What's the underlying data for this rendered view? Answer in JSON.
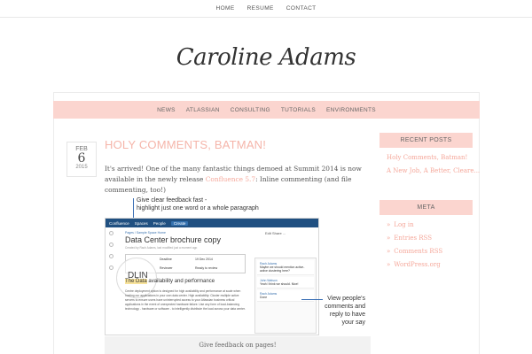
{
  "top_nav": [
    "HOME",
    "RESUME",
    "CONTACT"
  ],
  "logo": "Caroline Adams",
  "main_nav": [
    "NEWS",
    "ATLASSIAN",
    "CONSULTING",
    "TUTORIALS",
    "ENVIRONMENTS"
  ],
  "post": {
    "date": {
      "month": "FEB",
      "day": "6",
      "year": "2015"
    },
    "title": "HOLY COMMENTS, BATMAN!",
    "body_pre": "It's arrived! One of the many fantastic things demoed at Summit 2014 is now available in the newly release ",
    "body_link": "Confluence 5.7",
    "body_post": ": Inline commenting (and file commenting, too!)",
    "callout_top": "Give clear feedback fast -\nhighlight just one word or a whole paragraph",
    "callout_right": "View people's\ncomments and\nreply to have\nyour say",
    "caption": "Give feedback on pages!"
  },
  "screenshot": {
    "bar_items": [
      "Confluence",
      "Spaces",
      "People",
      "Create"
    ],
    "crumbs": "Pages / Sample Space Home",
    "page_title": "Data Center brochure copy",
    "meta": "Created by Rach Adams, last modified just a moment ago",
    "table_cells": [
      "Deadline",
      "19 Dec 2014",
      "Reviewer",
      "Ready to review"
    ],
    "highlight_word": "The Data",
    "highlight_rest": " availability and performance",
    "body_text": "Centre deployment option is designed for high availability and performance at scale when hosting our applications in your own data center. High availability: Cluster multiple active servers to ensure users have uninterrupted access to your Atlassian business critical applications in the event of unexpected hardware failure. Use any form of load-balancing technology - hardware or software - to intelligently distribute the load across your data center.",
    "lens_text": "DLIN",
    "toolbar": "Edit   Share   ...",
    "comments": [
      {
        "name": "Rach Adams",
        "text": "Maybe we should mention active-active clustering here?"
      },
      {
        "name": "John Watson",
        "text": "Yeah I think we should. Nice!"
      },
      {
        "name": "Rach Adams",
        "text": "Done"
      }
    ]
  },
  "sidebar": {
    "recent_title": "RECENT POSTS",
    "recent_posts": [
      "Holy Comments, Batman!",
      "A New Job, A Better, Cleare..."
    ],
    "meta_title": "META",
    "meta_links": [
      "Log in",
      "Entries RSS",
      "Comments RSS",
      "WordPress.org"
    ]
  },
  "colors": {
    "accent": "#f5a89b",
    "pink_bar": "#fbd5cf",
    "confluence_blue": "#205081"
  }
}
